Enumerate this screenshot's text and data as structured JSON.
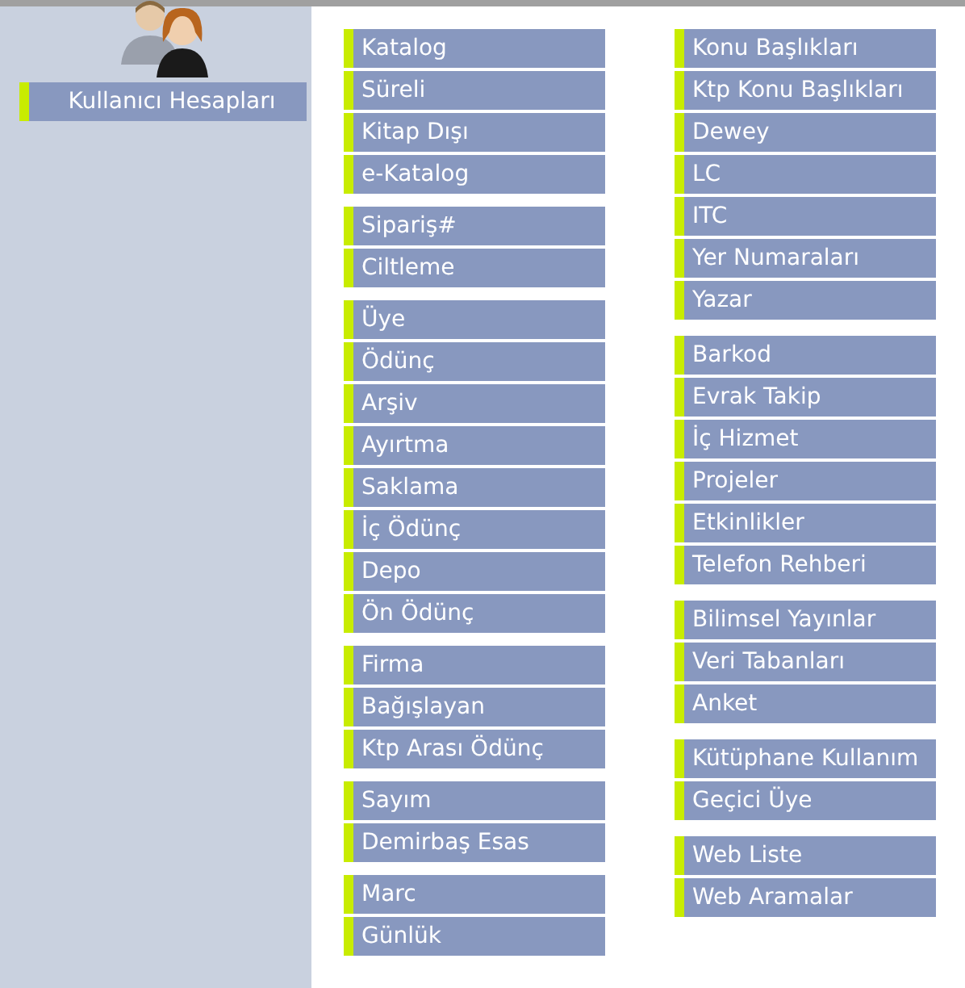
{
  "sidebar": {
    "items": [
      {
        "label": "Kullanıcı Hesapları"
      }
    ]
  },
  "columns": [
    [
      [
        "Katalog",
        "Süreli",
        "Kitap Dışı",
        "e-Katalog"
      ],
      [
        "Sipariş#",
        "Ciltleme"
      ],
      [
        "Üye",
        "Ödünç",
        "Arşiv",
        "Ayırtma",
        "Saklama",
        "İç Ödünç",
        "Depo",
        "Ön Ödünç"
      ],
      [
        "Firma",
        "Bağışlayan",
        "Ktp Arası Ödünç"
      ],
      [
        "Sayım",
        "Demirbaş Esas"
      ],
      [
        "Marc",
        "Günlük"
      ]
    ],
    [
      [
        "Konu Başlıkları",
        "Ktp Konu Başlıkları",
        "Dewey",
        "LC",
        "ITC",
        "Yer Numaraları",
        "Yazar"
      ],
      [
        "Barkod",
        "Evrak Takip",
        "İç Hizmet",
        "Projeler",
        "Etkinlikler",
        "Telefon Rehberi"
      ],
      [
        "Bilimsel Yayınlar",
        "Veri Tabanları",
        "Anket"
      ],
      [
        "Kütüphane Kullanım",
        "Geçici Üye"
      ],
      [
        "Web Liste",
        "Web Aramalar"
      ]
    ]
  ]
}
